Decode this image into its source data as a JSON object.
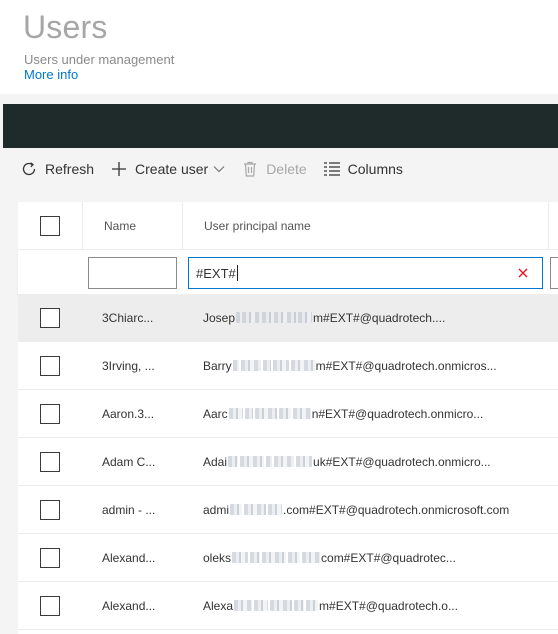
{
  "header": {
    "title": "Users",
    "subtitle": "Users under management",
    "more_info": "More info"
  },
  "toolbar": {
    "refresh": "Refresh",
    "create_user": "Create user",
    "delete": "Delete",
    "columns": "Columns",
    "icons": {
      "refresh": "refresh-icon",
      "create": "plus-icon",
      "delete": "trash-icon",
      "columns": "columns-icon"
    }
  },
  "grid": {
    "columns": [
      "Name",
      "User principal name"
    ],
    "filters": {
      "name": "",
      "upn": "#EXT#"
    },
    "rows": [
      {
        "name": "3Chiarc...",
        "upn_start": "Josep",
        "upn_end": "m#EXT#@quadrotech....",
        "selected": true
      },
      {
        "name": "3Irving, ...",
        "upn_start": "Barry",
        "upn_end": "m#EXT#@quadrotech.onmicros...",
        "selected": false
      },
      {
        "name": "Aaron.3...",
        "upn_start": "Aarc",
        "upn_end": "n#EXT#@quadrotech.onmicro...",
        "selected": false
      },
      {
        "name": "Adam C...",
        "upn_start": "Adai",
        "upn_end": "uk#EXT#@quadrotech.onmicro...",
        "selected": false
      },
      {
        "name": "admin - ...",
        "upn_start": "admi",
        "upn_end": ".com#EXT#@quadrotech.onmicrosoft.com",
        "selected": false
      },
      {
        "name": "Alexand...",
        "upn_start": "oleks",
        "upn_end": "com#EXT#@quadrotec...",
        "selected": false
      },
      {
        "name": "Alexand...",
        "upn_start": "Alexa",
        "upn_end": "m#EXT#@quadrotech.o...",
        "selected": false
      }
    ]
  },
  "colors": {
    "accent": "#0078d4",
    "dark_bar": "#1f2a2a",
    "selected_row": "#ededed"
  }
}
